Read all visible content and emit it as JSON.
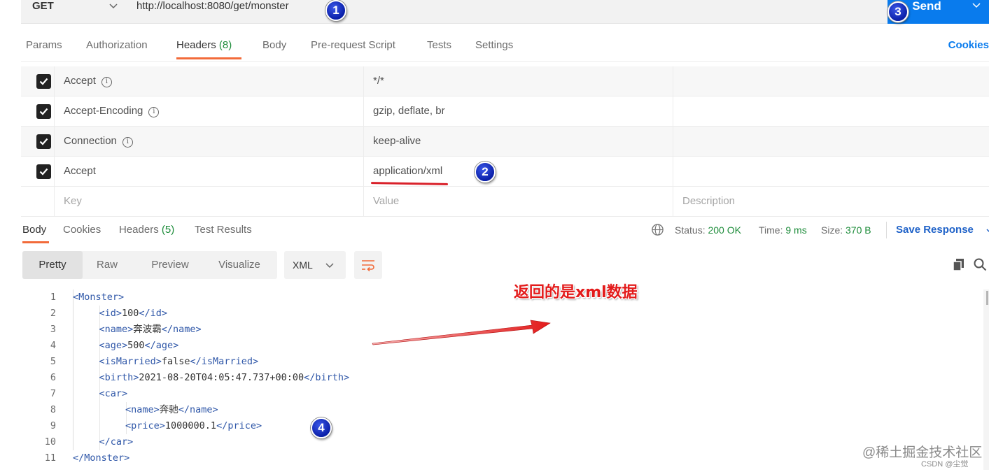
{
  "request": {
    "method": "GET",
    "url": "http://localhost:8080/get/monster",
    "send_label": "Send"
  },
  "badges": [
    "1",
    "2",
    "3",
    "4"
  ],
  "request_tabs": [
    {
      "label": "Params"
    },
    {
      "label": "Authorization"
    },
    {
      "label": "Headers",
      "count": "(8)",
      "active": true
    },
    {
      "label": "Body"
    },
    {
      "label": "Pre-request Script"
    },
    {
      "label": "Tests"
    },
    {
      "label": "Settings"
    }
  ],
  "cookies_link": "Cookies",
  "headers": [
    {
      "key": "Accept",
      "value": "*/*",
      "checked": true,
      "info": true
    },
    {
      "key": "Accept-Encoding",
      "value": "gzip, deflate, br",
      "checked": true,
      "info": true
    },
    {
      "key": "Connection",
      "value": "keep-alive",
      "checked": true,
      "info": true
    },
    {
      "key": "Accept",
      "value": "application/xml",
      "checked": true,
      "info": false
    }
  ],
  "headers_placeholder": {
    "key": "Key",
    "value": "Value",
    "description": "Description"
  },
  "response_tabs": [
    {
      "label": "Body",
      "active": true
    },
    {
      "label": "Cookies"
    },
    {
      "label": "Headers",
      "count": "(5)"
    },
    {
      "label": "Test Results"
    }
  ],
  "status": {
    "status_label": "Status:",
    "status_value": "200 OK",
    "time_label": "Time:",
    "time_value": "9 ms",
    "size_label": "Size:",
    "size_value": "370 B",
    "save_response": "Save Response"
  },
  "view_modes": [
    "Pretty",
    "Raw",
    "Preview",
    "Visualize"
  ],
  "active_view": "Pretty",
  "format": "XML",
  "code_lines": [
    {
      "n": "1",
      "indent": 0,
      "open": "<Monster>",
      "text": "",
      "close": ""
    },
    {
      "n": "2",
      "indent": 1,
      "open": "<id>",
      "text": "100",
      "close": "</id>"
    },
    {
      "n": "3",
      "indent": 1,
      "open": "<name>",
      "text": "奔波霸",
      "close": "</name>"
    },
    {
      "n": "4",
      "indent": 1,
      "open": "<age>",
      "text": "500",
      "close": "</age>"
    },
    {
      "n": "5",
      "indent": 1,
      "open": "<isMarried>",
      "text": "false",
      "close": "</isMarried>"
    },
    {
      "n": "6",
      "indent": 1,
      "open": "<birth>",
      "text": "2021-08-20T04:05:47.737+00:00",
      "close": "</birth>"
    },
    {
      "n": "7",
      "indent": 1,
      "open": "<car>",
      "text": "",
      "close": ""
    },
    {
      "n": "8",
      "indent": 2,
      "open": "<name>",
      "text": "奔驰",
      "close": "</name>"
    },
    {
      "n": "9",
      "indent": 2,
      "open": "<price>",
      "text": "1000000.1",
      "close": "</price>"
    },
    {
      "n": "10",
      "indent": 1,
      "open": "</car>",
      "text": "",
      "close": ""
    },
    {
      "n": "11",
      "indent": 0,
      "open": "</Monster>",
      "text": "",
      "close": ""
    }
  ],
  "annotation": "返回的是xml数据",
  "watermark": "@稀土掘金技术社区",
  "watermark_sub": "CSDN @尘觉",
  "colors": {
    "accent": "#097bed",
    "tab_underline": "#f26b3a",
    "status_ok": "#1d8c3a",
    "xml_tag": "#2f57a8",
    "annotation": "#e31b1b",
    "badge": "#1a2fc4"
  }
}
